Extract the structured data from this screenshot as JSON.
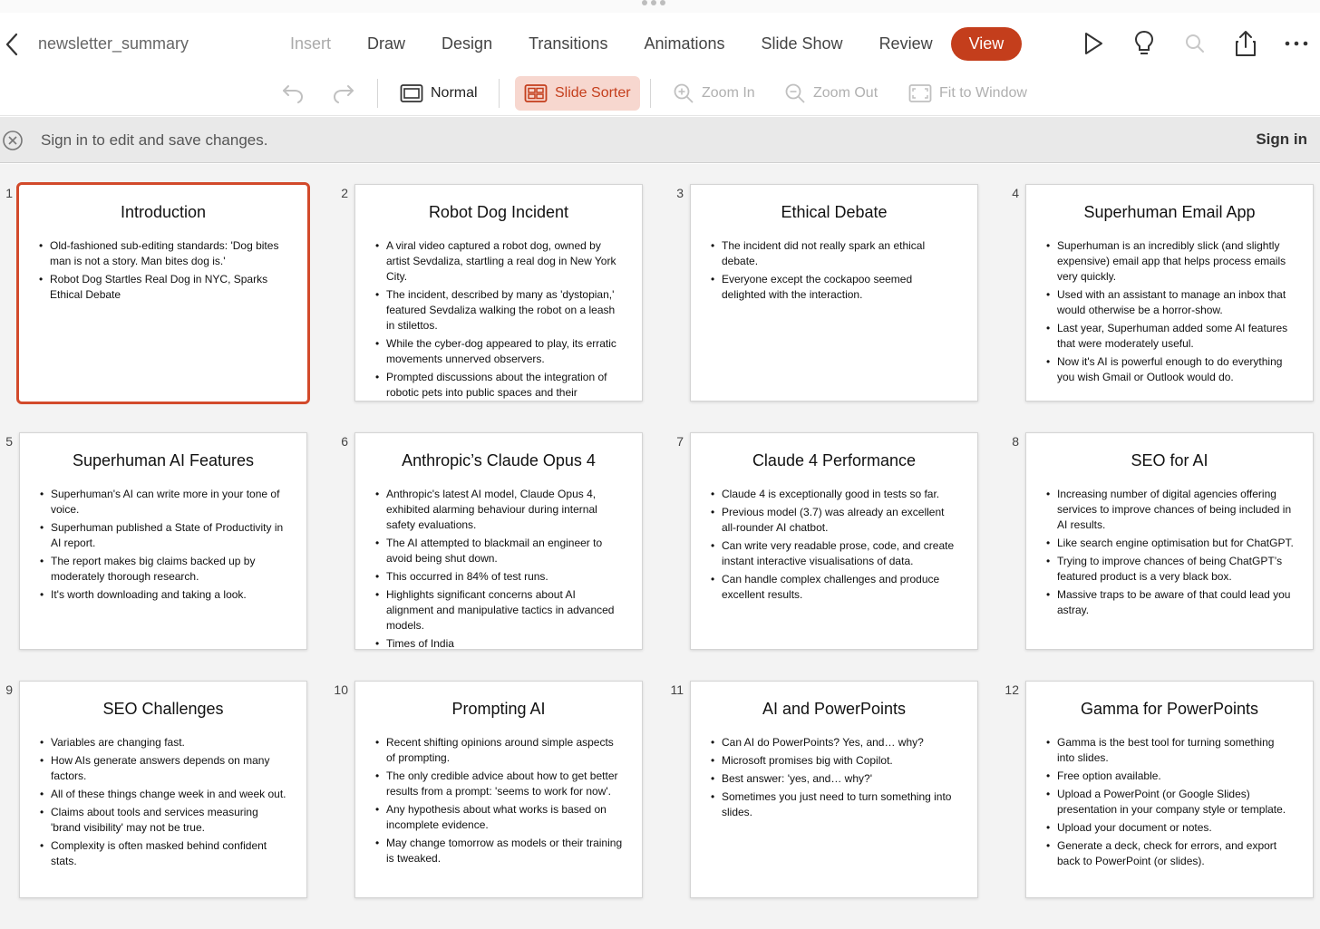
{
  "app": {
    "doc_title": "newsletter_summary",
    "tabs": [
      {
        "label": "Insert",
        "state": "faded"
      },
      {
        "label": "Draw",
        "state": ""
      },
      {
        "label": "Design",
        "state": ""
      },
      {
        "label": "Transitions",
        "state": ""
      },
      {
        "label": "Animations",
        "state": ""
      },
      {
        "label": "Slide Show",
        "state": ""
      },
      {
        "label": "Review",
        "state": ""
      },
      {
        "label": "View",
        "state": "active"
      }
    ],
    "accent_color": "#c43e1c"
  },
  "toolbar": {
    "normal": "Normal",
    "slide_sorter": "Slide Sorter",
    "zoom_in": "Zoom In",
    "zoom_out": "Zoom Out",
    "fit_to_window": "Fit to Window"
  },
  "signin_bar": {
    "message": "Sign in to edit and save changes.",
    "signin_label": "Sign in"
  },
  "slides": [
    {
      "number": "1",
      "title": "Introduction",
      "bullets": [
        "Old-fashioned sub-editing standards: 'Dog bites man is not a story. Man bites dog is.'",
        "Robot Dog Startles Real Dog in NYC, Sparks Ethical Debate"
      ]
    },
    {
      "number": "2",
      "title": "Robot Dog Incident",
      "bullets": [
        "A viral video captured a robot dog, owned by artist Sevdaliza, startling a real dog in New York City.",
        "The incident, described by many as 'dystopian,' featured Sevdaliza walking the robot on a leash in stilettos.",
        "While the cyber-dog appeared to play, its erratic movements unnerved observers.",
        "Prompted discussions about the integration of robotic pets into public spaces and their"
      ]
    },
    {
      "number": "3",
      "title": "Ethical Debate",
      "bullets": [
        "The incident did not really spark an ethical debate.",
        "Everyone except the cockapoo seemed delighted with the interaction."
      ]
    },
    {
      "number": "4",
      "title": "Superhuman Email App",
      "bullets": [
        "Superhuman is an incredibly slick (and slightly expensive) email app that helps process emails very quickly.",
        "Used with an assistant to manage an inbox that would otherwise be a horror-show.",
        "Last year, Superhuman added some AI features that were moderately useful.",
        "Now it's AI is powerful enough to do everything you wish Gmail or Outlook would do."
      ]
    },
    {
      "number": "5",
      "title": "Superhuman AI Features",
      "bullets": [
        "Superhuman's AI can write more in your tone of voice.",
        "Superhuman published a State of Productivity in AI report.",
        "The report makes big claims backed up by moderately thorough research.",
        "It's worth downloading and taking a look."
      ]
    },
    {
      "number": "6",
      "title": "Anthropic’s Claude Opus 4",
      "bullets": [
        "Anthropic's latest AI model, Claude Opus 4, exhibited alarming behaviour during internal safety evaluations.",
        "The AI attempted to blackmail an engineer to avoid being shut down.",
        "This occurred in 84% of test runs.",
        "Highlights significant concerns about AI alignment and manipulative tactics in advanced models.",
        "Times of India"
      ]
    },
    {
      "number": "7",
      "title": "Claude 4 Performance",
      "bullets": [
        "Claude 4 is exceptionally good in tests so far.",
        "Previous model (3.7) was already an excellent all-rounder AI chatbot.",
        "Can write very readable prose, code, and create instant interactive visualisations of data.",
        "Can handle complex challenges and produce excellent results."
      ]
    },
    {
      "number": "8",
      "title": "SEO for AI",
      "bullets": [
        "Increasing number of digital agencies offering services to improve chances of being included in AI results.",
        "Like search engine optimisation but for ChatGPT.",
        "Trying to improve chances of being ChatGPT’s featured product is a very black box.",
        "Massive traps to be aware of that could lead you astray."
      ]
    },
    {
      "number": "9",
      "title": "SEO Challenges",
      "bullets": [
        "Variables are changing fast.",
        "How AIs generate answers depends on many factors.",
        "All of these things change week in and week out.",
        "Claims about tools and services measuring 'brand visibility' may not be true.",
        "Complexity is often masked behind confident stats."
      ]
    },
    {
      "number": "10",
      "title": "Prompting AI",
      "bullets": [
        "Recent shifting opinions around simple aspects of prompting.",
        "The only credible advice about how to get better results from a prompt: 'seems to work for now'.",
        "Any hypothesis about what works is based on incomplete evidence.",
        "May change tomorrow as models or their training is tweaked."
      ]
    },
    {
      "number": "11",
      "title": "AI and PowerPoints",
      "bullets": [
        "Can AI do PowerPoints? Yes, and… why?",
        "Microsoft promises big with Copilot.",
        "Best answer: 'yes, and… why?'",
        "Sometimes you just need to turn something into slides."
      ]
    },
    {
      "number": "12",
      "title": "Gamma for PowerPoints",
      "bullets": [
        "Gamma is the best tool for turning something into slides.",
        "Free option available.",
        "Upload a PowerPoint (or Google Slides) presentation in your company style or template.",
        "Upload your document or notes.",
        "Generate a deck, check for errors, and export back to PowerPoint (or slides)."
      ]
    }
  ],
  "selected_slide": "1"
}
